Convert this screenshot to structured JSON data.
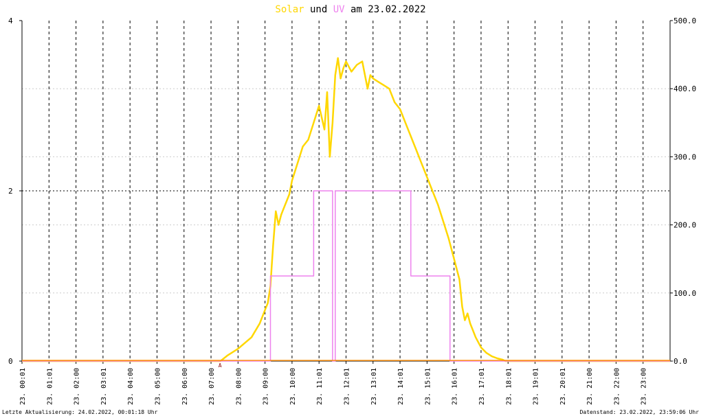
{
  "chart_data": {
    "type": "line",
    "title_parts": [
      {
        "text": "Solar",
        "color": "#FFD700"
      },
      {
        "text": " und ",
        "color": "#000000"
      },
      {
        "text": "UV",
        "color": "#EE82EE"
      },
      {
        "text": " am 23.02.2022",
        "color": "#000000"
      }
    ],
    "x_range": [
      0,
      24
    ],
    "x_tick_labels": [
      "23. 00:01",
      "23. 01:01",
      "23. 02:00",
      "23. 03:01",
      "23. 04:00",
      "23. 05:00",
      "23. 06:00",
      "23. 07:00",
      "23. 08:00",
      "23. 09:00",
      "23. 10:00",
      "23. 11:01",
      "23. 12:01",
      "23. 13:01",
      "23. 14:01",
      "23. 15:01",
      "23. 16:01",
      "23. 17:01",
      "23. 18:01",
      "23. 19:01",
      "23. 20:01",
      "23. 21:00",
      "23. 22:00",
      "23. 23:00"
    ],
    "left_axis": {
      "range": [
        0,
        4
      ],
      "ticks": [
        "0",
        "2",
        "4"
      ]
    },
    "right_axis": {
      "range": [
        0,
        500
      ],
      "ticks": [
        "0.0",
        "100.0",
        "200.0",
        "300.0",
        "400.0",
        "500.0"
      ]
    },
    "marker_label": "A",
    "grid": true,
    "series": [
      {
        "name": "Solar",
        "axis": "right",
        "color": "#FFD700",
        "x": [
          0,
          7.35,
          7.6,
          8.0,
          8.5,
          8.8,
          9.0,
          9.1,
          9.2,
          9.25,
          9.3,
          9.4,
          9.5,
          9.6,
          9.7,
          9.8,
          9.9,
          10.0,
          10.2,
          10.4,
          10.6,
          10.8,
          11.0,
          11.2,
          11.3,
          11.4,
          11.5,
          11.6,
          11.7,
          11.8,
          11.9,
          12.0,
          12.2,
          12.4,
          12.6,
          12.8,
          12.9,
          13.0,
          13.2,
          13.4,
          13.6,
          13.8,
          14.0,
          14.2,
          14.4,
          14.6,
          14.8,
          15.0,
          15.2,
          15.4,
          15.6,
          15.8,
          16.0,
          16.2,
          16.3,
          16.4,
          16.5,
          16.6,
          16.7,
          16.8,
          17.0,
          17.2,
          17.4,
          17.6,
          17.8,
          17.9,
          24
        ],
        "y": [
          0,
          0,
          8,
          18,
          35,
          55,
          75,
          85,
          110,
          140,
          170,
          220,
          200,
          215,
          225,
          235,
          245,
          265,
          290,
          315,
          325,
          350,
          375,
          340,
          395,
          300,
          350,
          420,
          445,
          415,
          430,
          440,
          425,
          435,
          440,
          400,
          420,
          415,
          410,
          405,
          400,
          380,
          370,
          350,
          330,
          310,
          290,
          270,
          250,
          230,
          205,
          180,
          150,
          120,
          80,
          60,
          70,
          55,
          45,
          35,
          20,
          12,
          7,
          4,
          2,
          0,
          0
        ]
      },
      {
        "name": "UV",
        "axis": "left",
        "color": "#EE82EE",
        "x": [
          0,
          9.2,
          9.2,
          10.8,
          10.8,
          11.5,
          11.5,
          11.6,
          11.6,
          14.4,
          14.4,
          15.85,
          15.85,
          24
        ],
        "y": [
          0,
          0,
          1,
          1,
          2,
          2,
          0,
          0,
          2,
          2,
          1,
          1,
          0,
          0
        ]
      }
    ]
  },
  "footer": {
    "left": "Letzte Aktualisierung: 24.02.2022, 00:01:18 Uhr",
    "right": "Datenstand: 23.02.2022, 23:59:06 Uhr"
  }
}
